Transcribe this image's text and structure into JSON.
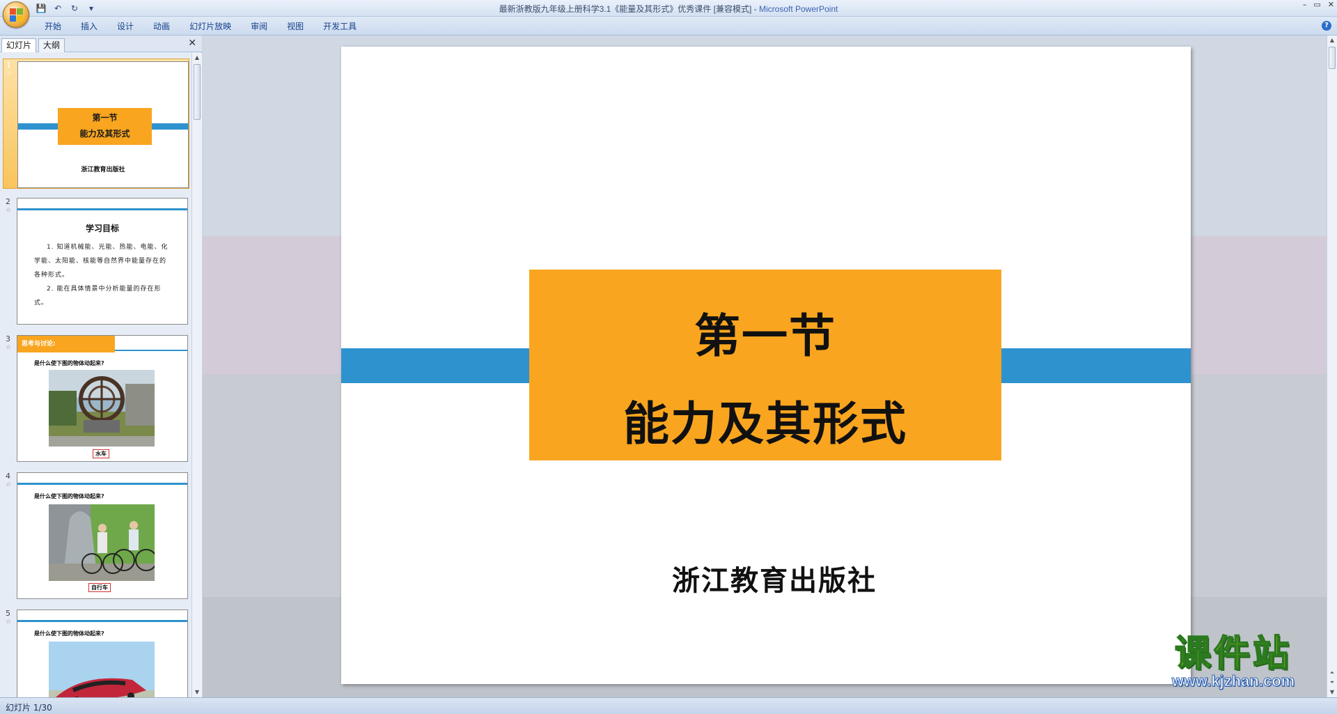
{
  "window": {
    "title": "最新浙教版九年级上册科学3.1《能量及其形式》优秀课件 [兼容模式]",
    "separator": " - ",
    "app_name": "Microsoft PowerPoint",
    "controls": [
      "–",
      "▭",
      "✕"
    ]
  },
  "quick_access": {
    "save": "💾",
    "undo": "↶",
    "redo": "↻",
    "more": "▾"
  },
  "ribbon": {
    "tabs": [
      "开始",
      "插入",
      "设计",
      "动画",
      "幻灯片放映",
      "审阅",
      "视图",
      "开发工具"
    ],
    "help": "?"
  },
  "left_pane": {
    "tab_slides": "幻灯片",
    "tab_outline": "大纲",
    "close": "✕",
    "thumbnails": [
      {
        "num": "1",
        "title1": "第一节",
        "title2": "能力及其形式",
        "publisher": "浙江教育出版社"
      },
      {
        "num": "2",
        "title": "学习目标",
        "item1": "1. 知道机械能、光能、热能、电能、化学能、太阳能、核能等自然界中能量存在的各种形式。",
        "item2": "2. 能在具体情景中分析能量的存在形式。"
      },
      {
        "num": "3",
        "label": "思考与讨论:",
        "question": "是什么使下图的物体动起来?",
        "caption": "水车"
      },
      {
        "num": "4",
        "question": "是什么使下图的物体动起来?",
        "caption": "自行车"
      },
      {
        "num": "5",
        "question": "是什么使下图的物体动起来?"
      }
    ],
    "star": "☆"
  },
  "slide": {
    "title_line1": "第一节",
    "title_line2": "能力及其形式",
    "publisher": "浙江教育出版社"
  },
  "watermark": {
    "main": "课件站",
    "url": "www.kjzhan.com"
  },
  "status": {
    "text": "幻灯片 1/30"
  },
  "colors": {
    "accent_orange": "#f9a51f",
    "accent_blue": "#2e92cf"
  }
}
